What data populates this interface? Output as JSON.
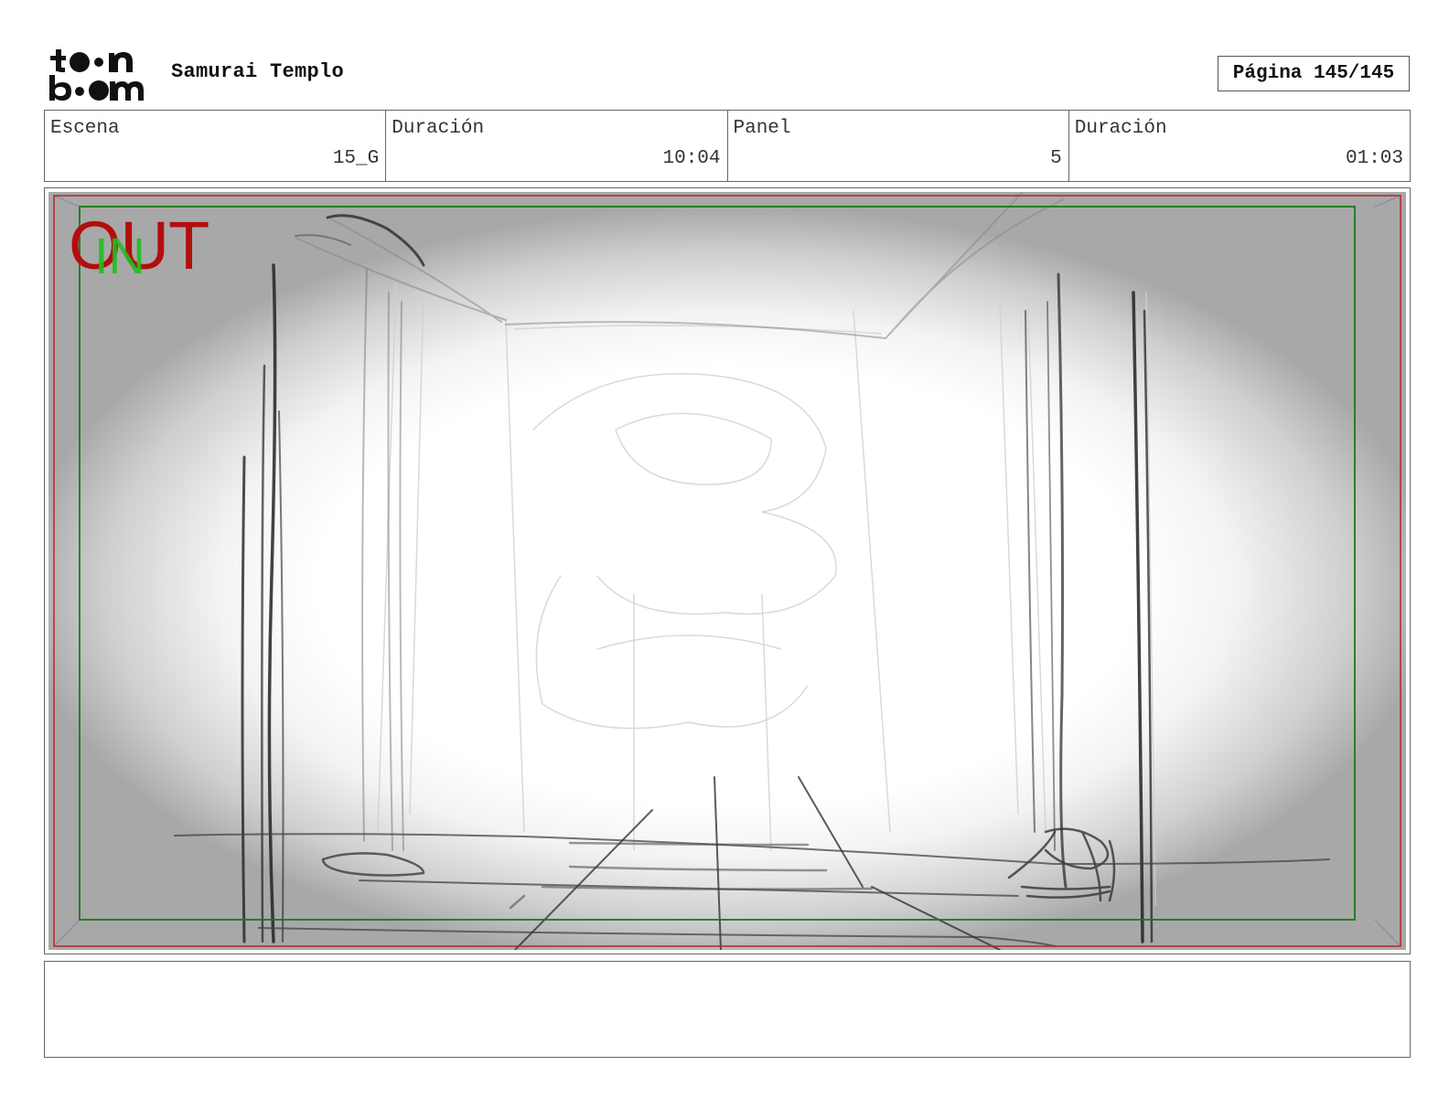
{
  "header": {
    "logo_text": "toon boom",
    "project_title": "Samurai Templo",
    "page_label": "Página 145/145"
  },
  "info": {
    "scene_label": "Escena",
    "scene_value": "15_G",
    "scene_duration_label": "Duración",
    "scene_duration_value": "10:04",
    "panel_label": "Panel",
    "panel_value": "5",
    "panel_duration_label": "Duración",
    "panel_duration_value": "01:03"
  },
  "frame": {
    "out_label": "OUT",
    "in_label": "IN",
    "colors": {
      "safe_area": "#1a7a1a",
      "frame_edge": "#b8242b",
      "out_text": "#b30d0d",
      "in_text": "#1fbf1f"
    }
  },
  "notes": {
    "text": ""
  }
}
